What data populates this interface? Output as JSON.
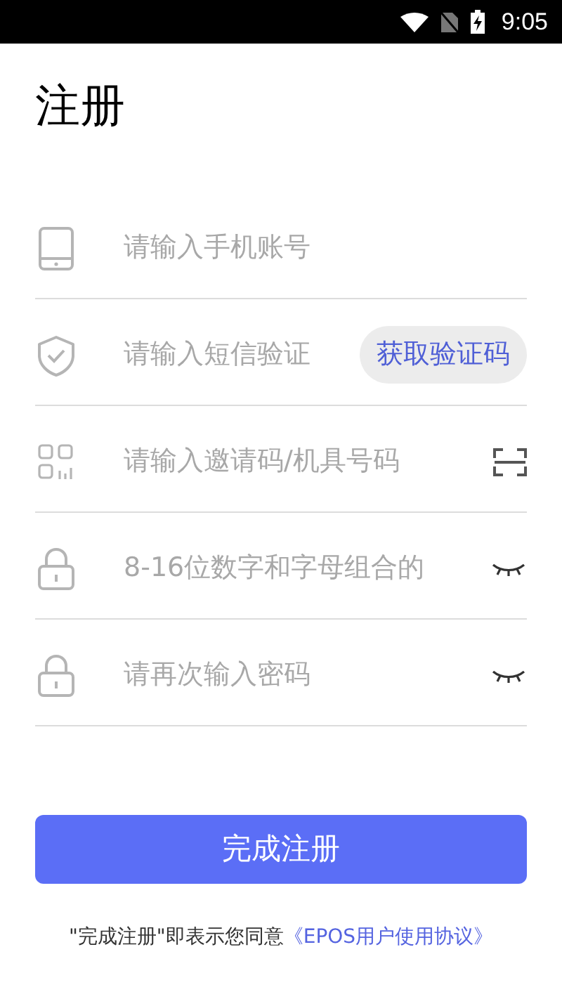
{
  "status_bar": {
    "time": "9:05"
  },
  "title": "注册",
  "fields": [
    {
      "kind": "phone",
      "placeholder": "请输入手机账号"
    },
    {
      "kind": "sms",
      "placeholder": "请输入短信验证",
      "trailing": {
        "kind": "button",
        "label": "获取验证码"
      }
    },
    {
      "kind": "invite",
      "placeholder": "请输入邀请码/机具号码",
      "trailing": {
        "kind": "scan"
      }
    },
    {
      "kind": "password",
      "placeholder": "8-16位数字和字母组合的",
      "trailing": {
        "kind": "eye"
      }
    },
    {
      "kind": "password",
      "placeholder": "请再次输入密码",
      "trailing": {
        "kind": "eye"
      }
    }
  ],
  "submit_button": "完成注册",
  "agreement": {
    "text": "\"完成注册\"即表示您同意",
    "link": "《EPOS用户使用协议》"
  }
}
